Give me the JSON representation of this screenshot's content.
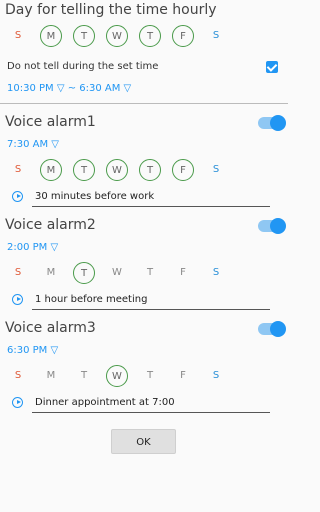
{
  "colors": {
    "accent": "#2196f3",
    "selected_day_border": "#4a9a4a",
    "sunday": "#e05a38",
    "saturday": "#2a90d8"
  },
  "hourly": {
    "title": "Day for telling the time hourly",
    "days": [
      {
        "label": "S",
        "selected": false
      },
      {
        "label": "M",
        "selected": true
      },
      {
        "label": "T",
        "selected": true
      },
      {
        "label": "W",
        "selected": true
      },
      {
        "label": "T",
        "selected": true
      },
      {
        "label": "F",
        "selected": true
      },
      {
        "label": "S",
        "selected": false
      }
    ],
    "dnd_label": "Do not tell during the set time",
    "dnd_checked": true,
    "dnd_range": "10:30 PM ▽  ~  6:30 AM ▽"
  },
  "alarms": [
    {
      "title": "Voice alarm1",
      "enabled": true,
      "time": "7:30 AM ▽",
      "days": [
        false,
        true,
        true,
        true,
        true,
        true,
        false
      ],
      "message": "30 minutes before work"
    },
    {
      "title": "Voice alarm2",
      "enabled": true,
      "time": "2:00 PM ▽",
      "days": [
        false,
        false,
        true,
        false,
        false,
        false,
        false
      ],
      "message": "1 hour before meeting"
    },
    {
      "title": "Voice alarm3",
      "enabled": true,
      "time": "6:30 PM ▽",
      "days": [
        false,
        false,
        false,
        true,
        false,
        false,
        false
      ],
      "message": "Dinner appointment at 7:00"
    }
  ],
  "day_letters": [
    "S",
    "M",
    "T",
    "W",
    "T",
    "F",
    "S"
  ],
  "ok_label": "OK"
}
